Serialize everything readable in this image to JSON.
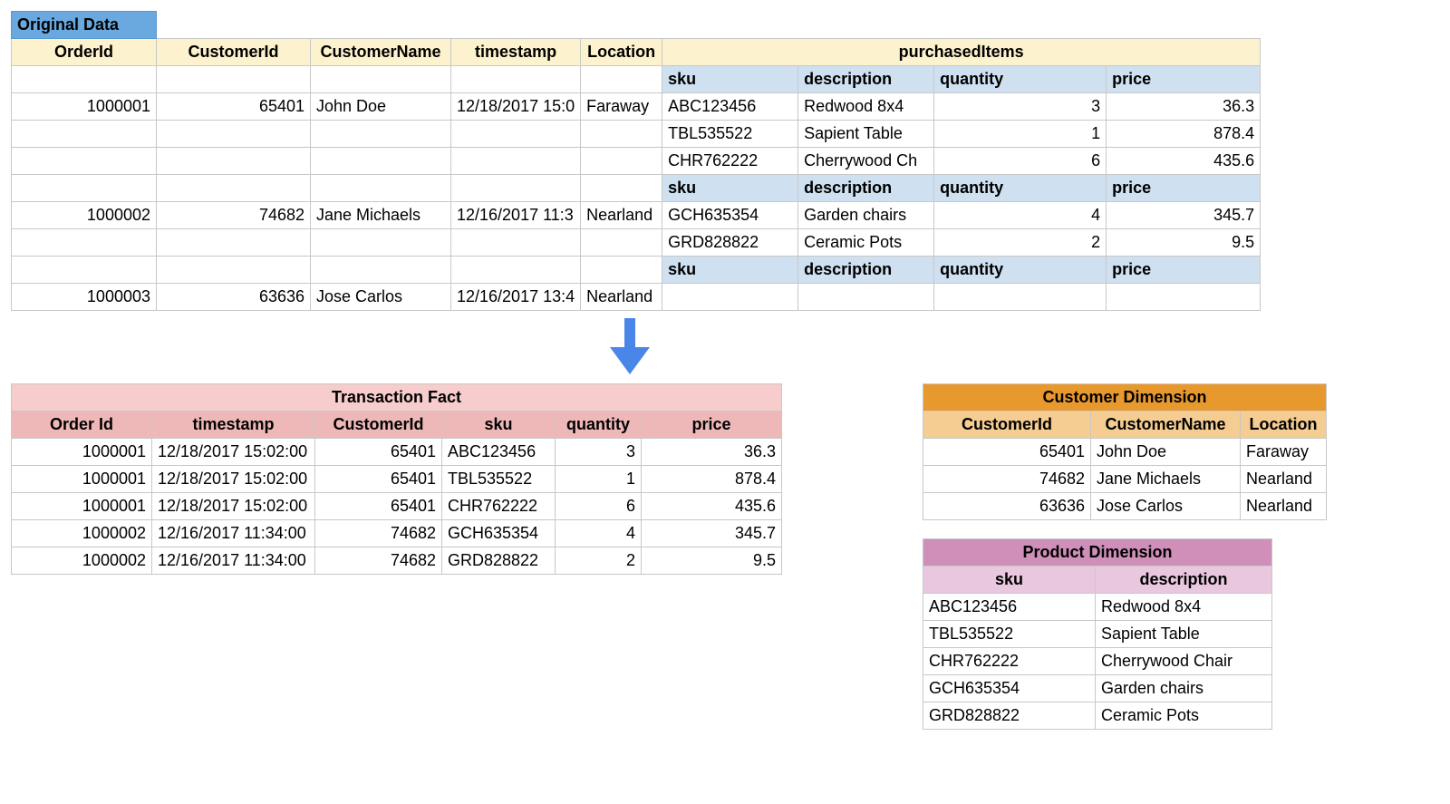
{
  "original": {
    "badge": "Original Data",
    "headers": [
      "OrderId",
      "CustomerId",
      "CustomerName",
      "timestamp",
      "Location",
      "purchasedItems"
    ],
    "subHeaders": [
      "sku",
      "description",
      "quantity",
      "price"
    ],
    "orders": [
      {
        "orderId": "1000001",
        "customerId": "65401",
        "customerName": "John Doe",
        "timestamp": "12/18/2017 15:0",
        "location": "Faraway",
        "items": [
          {
            "sku": "ABC123456",
            "description": "Redwood 8x4",
            "quantity": "3",
            "price": "36.3"
          },
          {
            "sku": "TBL535522",
            "description": "Sapient Table",
            "quantity": "1",
            "price": "878.4"
          },
          {
            "sku": "CHR762222",
            "description": "Cherrywood Ch",
            "quantity": "6",
            "price": "435.6"
          }
        ]
      },
      {
        "orderId": "1000002",
        "customerId": "74682",
        "customerName": "Jane Michaels",
        "timestamp": "12/16/2017 11:3",
        "location": "Nearland",
        "items": [
          {
            "sku": "GCH635354",
            "description": "Garden chairs",
            "quantity": "4",
            "price": "345.7"
          },
          {
            "sku": "GRD828822",
            "description": "Ceramic Pots",
            "quantity": "2",
            "price": "9.5"
          }
        ]
      },
      {
        "orderId": "1000003",
        "customerId": "63636",
        "customerName": "Jose Carlos",
        "timestamp": "12/16/2017 13:4",
        "location": "Nearland",
        "items": []
      }
    ]
  },
  "fact": {
    "title": "Transaction Fact",
    "headers": [
      "Order Id",
      "timestamp",
      "CustomerId",
      "sku",
      "quantity",
      "price"
    ],
    "rows": [
      [
        "1000001",
        "12/18/2017 15:02:00",
        "65401",
        "ABC123456",
        "3",
        "36.3"
      ],
      [
        "1000001",
        "12/18/2017 15:02:00",
        "65401",
        "TBL535522",
        "1",
        "878.4"
      ],
      [
        "1000001",
        "12/18/2017 15:02:00",
        "65401",
        "CHR762222",
        "6",
        "435.6"
      ],
      [
        "1000002",
        "12/16/2017 11:34:00",
        "74682",
        "GCH635354",
        "4",
        "345.7"
      ],
      [
        "1000002",
        "12/16/2017 11:34:00",
        "74682",
        "GRD828822",
        "2",
        "9.5"
      ]
    ]
  },
  "customer": {
    "title": "Customer Dimension",
    "headers": [
      "CustomerId",
      "CustomerName",
      "Location"
    ],
    "rows": [
      [
        "65401",
        "John Doe",
        "Faraway"
      ],
      [
        "74682",
        "Jane Michaels",
        "Nearland"
      ],
      [
        "63636",
        "Jose Carlos",
        "Nearland"
      ]
    ]
  },
  "product": {
    "title": "Product Dimension",
    "headers": [
      "sku",
      "description"
    ],
    "rows": [
      [
        "ABC123456",
        "Redwood 8x4"
      ],
      [
        "TBL535522",
        "Sapient Table"
      ],
      [
        "CHR762222",
        "Cherrywood Chair"
      ],
      [
        "GCH635354",
        "Garden chairs"
      ],
      [
        "GRD828822",
        "Ceramic Pots"
      ]
    ]
  }
}
